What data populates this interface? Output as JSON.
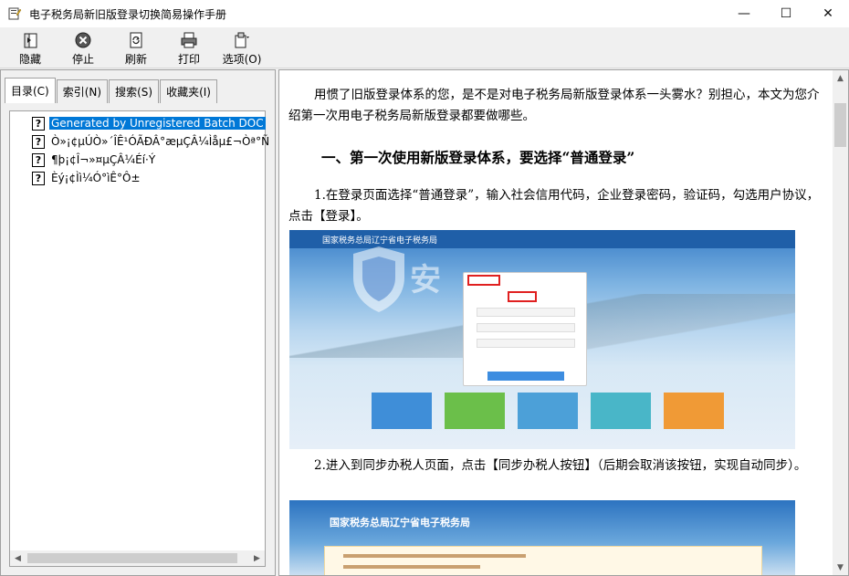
{
  "window": {
    "title": "电子税务局新旧版登录切换简易操作手册",
    "minimize_glyph": "—",
    "maximize_glyph": "☐",
    "close_glyph": "✕"
  },
  "toolbar": {
    "buttons": [
      {
        "label": "隐藏",
        "icon": "hide-icon"
      },
      {
        "label": "停止",
        "icon": "stop-icon"
      },
      {
        "label": "刷新",
        "icon": "refresh-icon"
      },
      {
        "label": "打印",
        "icon": "print-icon"
      },
      {
        "label": "选项(O)",
        "icon": "options-icon"
      }
    ]
  },
  "tabs": [
    {
      "label": "目录(C)",
      "active": true
    },
    {
      "label": "索引(N)",
      "active": false
    },
    {
      "label": "搜索(S)",
      "active": false
    },
    {
      "label": "收藏夹(I)",
      "active": false
    }
  ],
  "tree": {
    "items": [
      {
        "text": "Generated by Unregistered Batch DOC",
        "selected": true
      },
      {
        "text": "Ò»¡¢µÚÒ»´ÎÊ¹ÓÃÐÂ°æµÇÂ¼Ìåµ£¬Òª°Ñ",
        "selected": false
      },
      {
        "text": "¶þ¡¢Î¬»¤µÇÂ¼Éí·Ý",
        "selected": false
      },
      {
        "text": "Èý¡¢Ìì¼Ó°ìÊ°Ô±",
        "selected": false
      }
    ]
  },
  "content": {
    "intro": "用惯了旧版登录体系的您，是不是对电子税务局新版登录体系一头雾水？别担心，本文为您介绍第一次用电子税务局新版登录都要做哪些。",
    "heading": "一、第一次使用新版登录体系，要选择“普通登录”",
    "step1": "1.在登录页面选择“普通登录”，输入社会信用代码，企业登录密码，验证码，勾选用户协议，点击【登录】。",
    "step2": "2.进入到同步办税人页面，点击【同步办税人按钮】（后期会取消该按钮，实现自动同步）。",
    "screenshot1_banner": "国家税务总局辽宁省电子税务局",
    "screenshot2_title": "国家税务总局辽宁省电子税务局"
  },
  "colors": {
    "selection": "#0078d7",
    "window_bg": "#f0f0f0"
  }
}
